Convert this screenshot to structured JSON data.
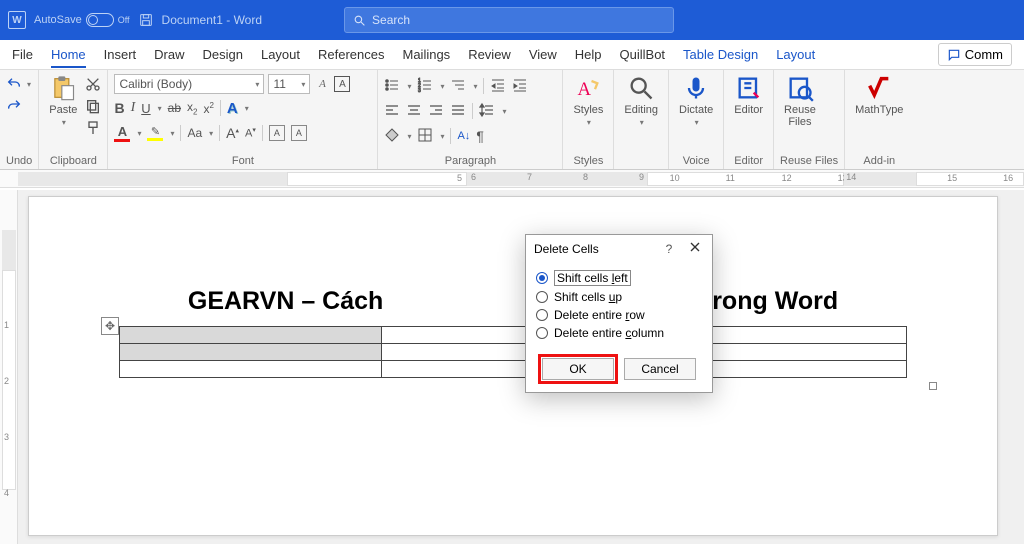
{
  "titlebar": {
    "autosave_label": "AutoSave",
    "autosave_state": "Off",
    "doc_title": "Document1 - Word",
    "search_placeholder": "Search"
  },
  "tabs": {
    "file": "File",
    "home": "Home",
    "insert": "Insert",
    "draw": "Draw",
    "design": "Design",
    "layout": "Layout",
    "references": "References",
    "mailings": "Mailings",
    "review": "Review",
    "view": "View",
    "help": "Help",
    "quillbot": "QuillBot",
    "table_design": "Table Design",
    "table_layout": "Layout",
    "comments": "Comm"
  },
  "ribbon": {
    "undo": "Undo",
    "clipboard": "Clipboard",
    "paste": "Paste",
    "font_group": "Font",
    "font_name": "Calibri (Body)",
    "font_size": "11",
    "paragraph": "Paragraph",
    "styles": "Styles",
    "editing": "Editing",
    "dictate": "Dictate",
    "voice": "Voice",
    "editor": "Editor",
    "reuse_files": "Reuse Files",
    "reuse_group": "Reuse Files",
    "mathtype": "MathType",
    "addin": "Add-in"
  },
  "document": {
    "heading_left": "GEARVN – Cách",
    "heading_right": "bảng trong Word"
  },
  "dialog": {
    "title": "Delete Cells",
    "help": "?",
    "opt_shift_left": "Shift cells left",
    "opt_shift_up": "Shift cells up",
    "opt_del_row": "Delete entire row",
    "opt_del_col": "Delete entire column",
    "ok": "OK",
    "cancel": "Cancel"
  }
}
